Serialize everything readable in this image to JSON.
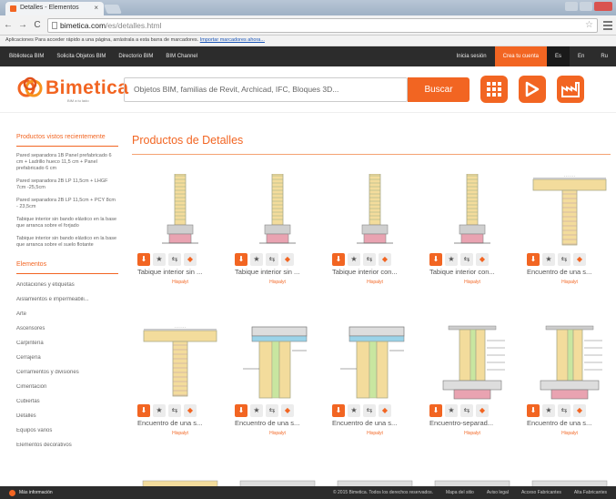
{
  "browser": {
    "tab_title": "Detalles - Elementos",
    "url_host": "bimetica.com",
    "url_path": "/es/detalles.html",
    "bookmarks_prefix": "Aplicaciones   Para acceder rápido a una página, arrástrala a esta barra de marcadores.",
    "bookmarks_link": "Importar marcadores ahora..."
  },
  "topnav": {
    "items": [
      "Biblioteca BIM",
      "Solicita Objetos BIM",
      "Directorio BIM",
      "BIM Channel"
    ],
    "login": "Inicia sesión",
    "signup": "Crea tu cuenta",
    "langs": [
      "Es",
      "En",
      "Ru"
    ]
  },
  "header": {
    "logo": "Bimetica",
    "logo_sub": "BIM a tu lado",
    "search_placeholder": "Objetos BIM, familias de Revit, Archicad, IFC, Bloques 3D...",
    "search_button": "Buscar"
  },
  "sidebar": {
    "recent_heading": "Productos vistos recientemente",
    "recent": [
      "Pared separadora 1B Panel prefabricado 6 cm + Ladrillo hueco 11,5 cm + Panel prefabricado 6 cm",
      "Pared separadora 2B LP 11,5cm + LHGF 7cm -25,5cm",
      "Pared separadora 2B LP 11,5cm + PCY 8cm - 23,5cm",
      "Tabique interior sin bando elástico en la base que arranca sobre el forjado",
      "Tabique interior sin bando elástico en la base que arranca sobre el suelo flotante"
    ],
    "elements_heading": "Elementos",
    "categories": [
      "Anotaciones y etiquetas",
      "Aislamientos e impermeabili...",
      "Arte",
      "Ascensores",
      "Carpintería",
      "Cerrajería",
      "Cerramientos y divisiones",
      "Cimentación",
      "Cubiertas",
      "Detalles",
      "Equipos varios",
      "Elementos decorativos"
    ]
  },
  "main": {
    "title": "Productos de Detalles",
    "products": [
      {
        "title": "Tabique interior sin ...",
        "brand": "Hispalyt",
        "kind": "wall"
      },
      {
        "title": "Tabique interior sin ...",
        "brand": "Hispalyt",
        "kind": "wall"
      },
      {
        "title": "Tabique interior con...",
        "brand": "Hispalyt",
        "kind": "wall"
      },
      {
        "title": "Tabique interior con...",
        "brand": "Hispalyt",
        "kind": "wall"
      },
      {
        "title": "Encuentro de una s...",
        "brand": "Hispalyt",
        "kind": "tee"
      },
      {
        "title": "Encuentro de una s...",
        "brand": "Hispalyt",
        "kind": "tee"
      },
      {
        "title": "Encuentro de una s...",
        "brand": "Hispalyt",
        "kind": "slab"
      },
      {
        "title": "Encuentro de una s...",
        "brand": "Hispalyt",
        "kind": "slab"
      },
      {
        "title": "Encuentro-separad...",
        "brand": "Hispalyt",
        "kind": "detail"
      },
      {
        "title": "Encuentro de una s...",
        "brand": "Hispalyt",
        "kind": "detail"
      }
    ]
  },
  "footer": {
    "more": "Más información",
    "copyright": "© 2015 Bimetica. Todos los derechos reservados.",
    "links": [
      "Mapa del sitio",
      "Aviso legal",
      "Acceso Fabricantes",
      "Alta Fabricantes"
    ]
  },
  "colors": {
    "accent": "#f26522",
    "dark": "#2c2c2c"
  }
}
